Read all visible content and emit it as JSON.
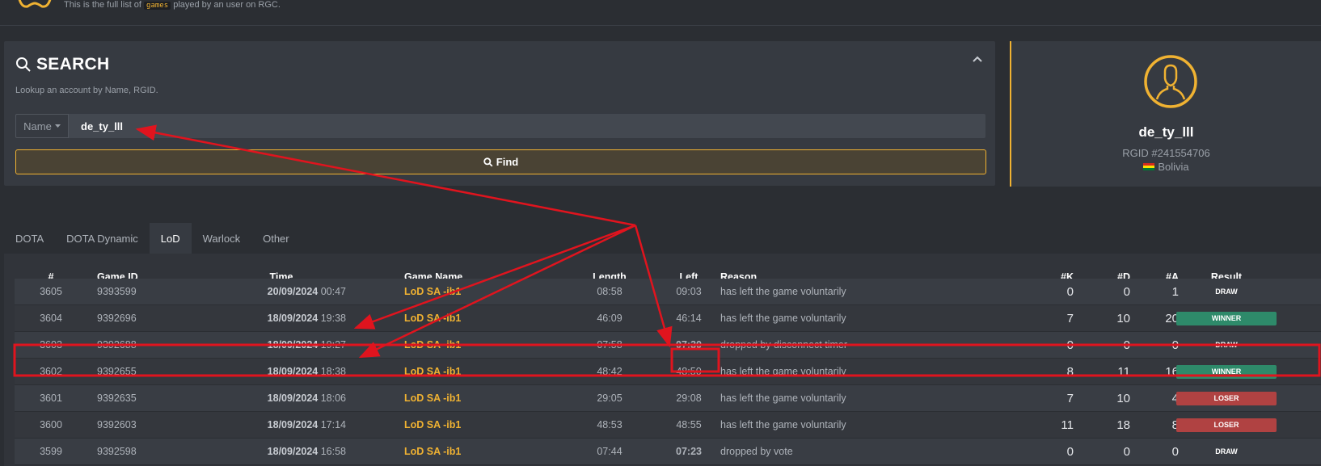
{
  "header": {
    "desc_prefix": "This is the full list of",
    "desc_code": "games",
    "desc_suffix": "played by an user on RGC."
  },
  "search": {
    "title": "SEARCH",
    "subtitle": "Lookup an account by Name, RGID.",
    "mode_label": "Name",
    "input_value": "de_ty_lll",
    "find_label": "Find"
  },
  "profile": {
    "name": "de_ty_lll",
    "rgid": "RGID #241554706",
    "country": "Bolivia"
  },
  "tabs": [
    {
      "label": "DOTA",
      "active": false
    },
    {
      "label": "DOTA Dynamic",
      "active": false
    },
    {
      "label": "LoD",
      "active": true
    },
    {
      "label": "Warlock",
      "active": false
    },
    {
      "label": "Other",
      "active": false
    }
  ],
  "table": {
    "headers": {
      "num": "#",
      "game_id": "Game ID",
      "time": "Time",
      "game_name": "Game Name",
      "length": "Length",
      "left": "Left",
      "reason": "Reason",
      "k": "#K",
      "d": "#D",
      "a": "#A",
      "result": "Result"
    },
    "rows": [
      {
        "num": "3605",
        "game_id": "9393599",
        "date": "20/09/2024",
        "clock": "00:47",
        "game_name": "LoD SA -ib1",
        "length": "08:58",
        "left": "09:03",
        "reason": "has left the game voluntarily",
        "k": "0",
        "d": "0",
        "a": "1",
        "result": "DRAW"
      },
      {
        "num": "3604",
        "game_id": "9392696",
        "date": "18/09/2024",
        "clock": "19:38",
        "game_name": "LoD SA -ib1",
        "length": "46:09",
        "left": "46:14",
        "reason": "has left the game voluntarily",
        "k": "7",
        "d": "10",
        "a": "20",
        "result": "WINNER"
      },
      {
        "num": "3603",
        "game_id": "9392688",
        "date": "18/09/2024",
        "clock": "19:27",
        "game_name": "LoD SA -ib1",
        "length": "07:58",
        "left": "07:30",
        "reason": "dropped by disconnect timer",
        "k": "0",
        "d": "0",
        "a": "0",
        "result": "DRAW"
      },
      {
        "num": "3602",
        "game_id": "9392655",
        "date": "18/09/2024",
        "clock": "18:38",
        "game_name": "LoD SA -ib1",
        "length": "48:42",
        "left": "48:50",
        "reason": "has left the game voluntarily",
        "k": "8",
        "d": "11",
        "a": "16",
        "result": "WINNER"
      },
      {
        "num": "3601",
        "game_id": "9392635",
        "date": "18/09/2024",
        "clock": "18:06",
        "game_name": "LoD SA -ib1",
        "length": "29:05",
        "left": "29:08",
        "reason": "has left the game voluntarily",
        "k": "7",
        "d": "10",
        "a": "4",
        "result": "LOSER"
      },
      {
        "num": "3600",
        "game_id": "9392603",
        "date": "18/09/2024",
        "clock": "17:14",
        "game_name": "LoD SA -ib1",
        "length": "48:53",
        "left": "48:55",
        "reason": "has left the game voluntarily",
        "k": "11",
        "d": "18",
        "a": "8",
        "result": "LOSER"
      },
      {
        "num": "3599",
        "game_id": "9392598",
        "date": "18/09/2024",
        "clock": "16:58",
        "game_name": "LoD SA -ib1",
        "length": "07:44",
        "left": "07:23",
        "reason": "dropped by vote",
        "k": "0",
        "d": "0",
        "a": "0",
        "result": "DRAW"
      }
    ]
  },
  "colors": {
    "accent": "#f0b232",
    "winner": "#2e8a6a",
    "loser": "#b04242",
    "annotation": "#e0141e"
  }
}
